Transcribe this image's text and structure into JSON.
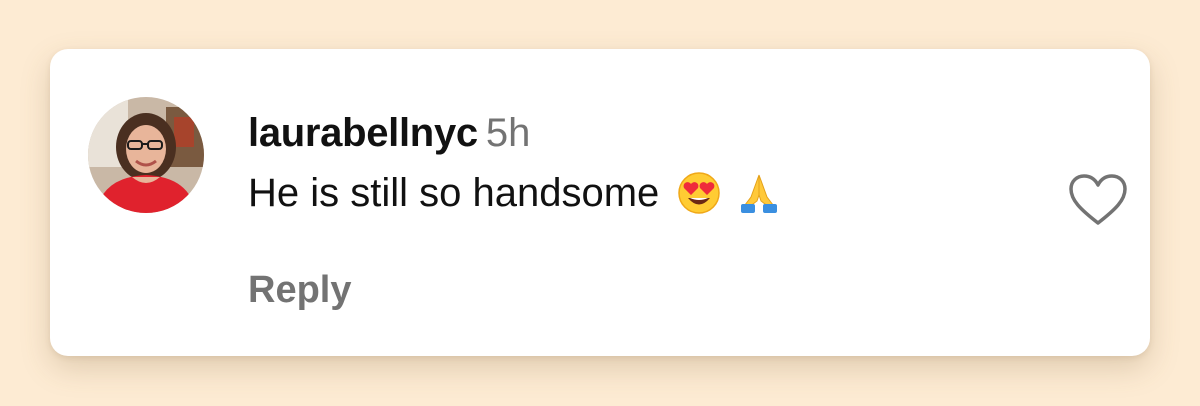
{
  "comment": {
    "username": "laurabellnyc",
    "timestamp": "5h",
    "text": "He is still so handsome",
    "emojis": [
      "heart-eyes-emoji",
      "folded-hands-emoji"
    ],
    "reply_label": "Reply",
    "like_icon": "heart-outline-icon"
  },
  "colors": {
    "background": "#fdebd3",
    "card": "#ffffff",
    "text": "#111111",
    "muted": "#737373"
  }
}
